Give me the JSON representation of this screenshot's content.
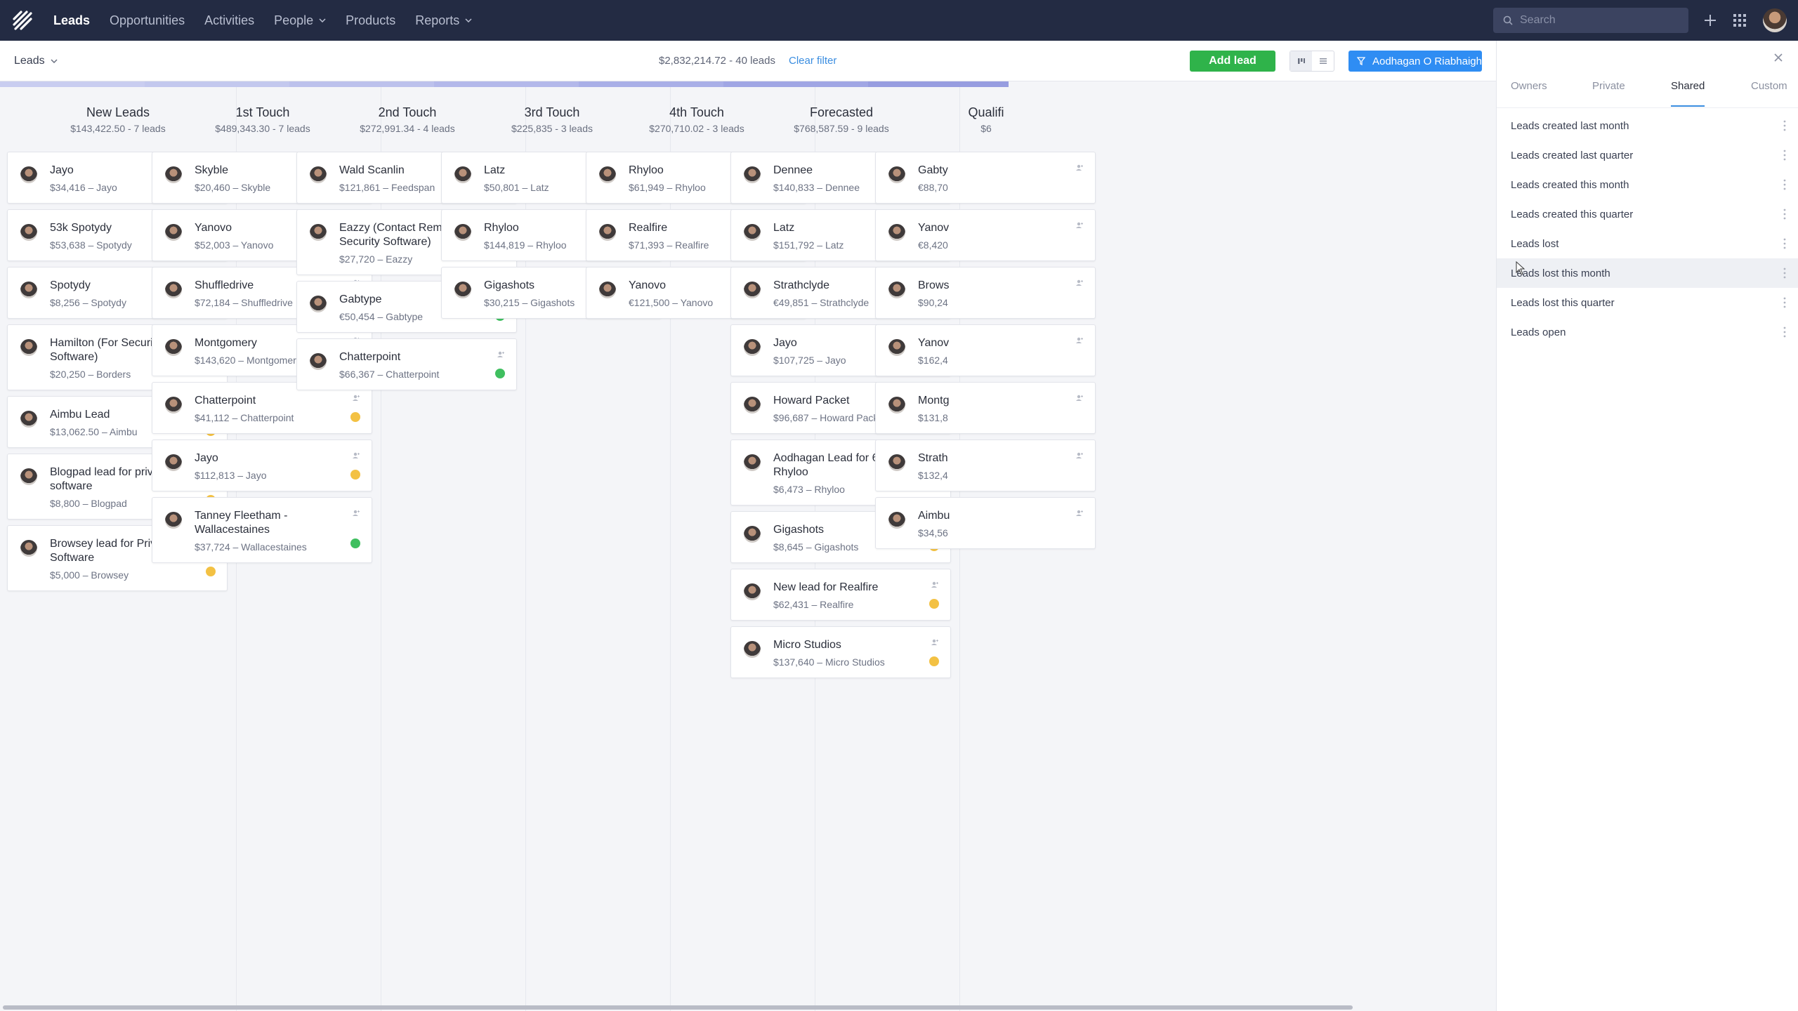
{
  "nav": {
    "items": [
      {
        "label": "Leads",
        "active": true,
        "dropdown": false
      },
      {
        "label": "Opportunities",
        "active": false,
        "dropdown": false
      },
      {
        "label": "Activities",
        "active": false,
        "dropdown": false
      },
      {
        "label": "People",
        "active": false,
        "dropdown": true
      },
      {
        "label": "Products",
        "active": false,
        "dropdown": false
      },
      {
        "label": "Reports",
        "active": false,
        "dropdown": true
      }
    ],
    "search_placeholder": "Search"
  },
  "toolbar": {
    "view_label": "Leads",
    "summary": "$2,832,214.72 - 40 leads",
    "clear_filter": "Clear filter",
    "add_lead": "Add lead",
    "owner_filter": "Aodhagan O Riabhaigh"
  },
  "columns": [
    {
      "title": "New Leads",
      "sub": "$143,422.50 - 7 leads",
      "color": "#c9cdf0",
      "cards": [
        {
          "title": "Jayo",
          "meta": "$34,416 – Jayo",
          "status": "yellow"
        },
        {
          "title": "53k Spotydy",
          "meta": "$53,638 – Spotydy",
          "status": "yellow"
        },
        {
          "title": "Spotydy",
          "meta": "$8,256 – Spotydy",
          "status": "yellow"
        },
        {
          "title": "Hamilton (For Security Software)",
          "meta": "$20,250 – Borders",
          "status": "yellow"
        },
        {
          "title": "Aimbu Lead",
          "meta": "$13,062.50 – Aimbu",
          "status": "yellow"
        },
        {
          "title": "Blogpad lead for privacy software",
          "meta": "$8,800 – Blogpad",
          "status": "yellow"
        },
        {
          "title": "Browsey lead for Privacy Software",
          "meta": "$5,000 – Browsey",
          "status": "yellow"
        }
      ]
    },
    {
      "title": "1st Touch",
      "sub": "$489,343.30 - 7 leads",
      "color": "#c3c8ee",
      "cards": [
        {
          "title": "Skyble",
          "meta": "$20,460 – Skyble",
          "status": "red"
        },
        {
          "title": "Yanovo",
          "meta": "$52,003 – Yanovo",
          "status": "yellow"
        },
        {
          "title": "Shuffledrive",
          "meta": "$72,184 – Shuffledrive",
          "status": "yellow"
        },
        {
          "title": "Montgomery",
          "meta": "$143,620 – Montgomery",
          "status": "yellow"
        },
        {
          "title": "Chatterpoint",
          "meta": "$41,112 – Chatterpoint",
          "status": "yellow"
        },
        {
          "title": "Jayo",
          "meta": "$112,813 – Jayo",
          "status": "yellow"
        },
        {
          "title": "Tanney Fleetham - Wallacestaines",
          "meta": "$37,724 – Wallacestaines",
          "status": "green"
        }
      ]
    },
    {
      "title": "2nd Touch",
      "sub": "$272,991.34 - 4 leads",
      "color": "#bcc1ec",
      "cards": [
        {
          "title": "Wald Scanlin",
          "meta": "$121,861 – Feedspan",
          "status": "yellow"
        },
        {
          "title": "Eazzy (Contact Remy Try for Security Software)",
          "meta": "$27,720 – Eazzy",
          "status": "yellow"
        },
        {
          "title": "Gabtype",
          "meta": "€50,454 – Gabtype",
          "status": "green"
        },
        {
          "title": "Chatterpoint",
          "meta": "$66,367 – Chatterpoint",
          "status": "green"
        }
      ]
    },
    {
      "title": "3rd Touch",
      "sub": "$225,835 - 3 leads",
      "color": "#b3b8ea",
      "cards": [
        {
          "title": "Latz",
          "meta": "$50,801 – Latz",
          "status": "yellow"
        },
        {
          "title": "Rhyloo",
          "meta": "$144,819 – Rhyloo",
          "status": "yellow"
        },
        {
          "title": "Gigashots",
          "meta": "$30,215 – Gigashots",
          "status": "yellow"
        }
      ]
    },
    {
      "title": "4th Touch",
      "sub": "$270,710.02 - 3 leads",
      "color": "#a9afe7",
      "cards": [
        {
          "title": "Rhyloo",
          "meta": "$61,949 – Rhyloo",
          "status": "red"
        },
        {
          "title": "Realfire",
          "meta": "$71,393 – Realfire",
          "status": "red"
        },
        {
          "title": "Yanovo",
          "meta": "€121,500 – Yanovo",
          "status": "yellow"
        }
      ]
    },
    {
      "title": "Forecasted",
      "sub": "$768,587.59 - 9 leads",
      "color": "#a0a6e4",
      "cards": [
        {
          "title": "Dennee",
          "meta": "$140,833 – Dennee",
          "status": "red"
        },
        {
          "title": "Latz",
          "meta": "$151,792 – Latz",
          "status": "red"
        },
        {
          "title": "Strathclyde",
          "meta": "€49,851 – Strathclyde",
          "status": "red"
        },
        {
          "title": "Jayo",
          "meta": "$107,725 – Jayo",
          "status": "yellow"
        },
        {
          "title": "Howard Packet",
          "meta": "$96,687 – Howard Packet",
          "status": "yellow"
        },
        {
          "title": "Aodhagan Lead for 6.5k Rhyloo",
          "meta": "$6,473 – Rhyloo",
          "status": "yellow"
        },
        {
          "title": "Gigashots",
          "meta": "$8,645 – Gigashots",
          "status": "yellow"
        },
        {
          "title": "New lead for Realfire",
          "meta": "$62,431 – Realfire",
          "status": "yellow"
        },
        {
          "title": "Micro Studios",
          "meta": "$137,640 – Micro Studios",
          "status": "yellow"
        }
      ]
    },
    {
      "title": "Qualifi",
      "sub": "$6",
      "color": "#979de0",
      "cards": [
        {
          "title": "Gabty",
          "meta": "€88,70",
          "status": ""
        },
        {
          "title": "Yanov",
          "meta": "€8,420",
          "status": ""
        },
        {
          "title": "Brows",
          "meta": "$90,24",
          "status": ""
        },
        {
          "title": "Yanov",
          "meta": "$162,4",
          "status": ""
        },
        {
          "title": "Montg",
          "meta": "$131,8",
          "status": ""
        },
        {
          "title": "Strath",
          "meta": "$132,4",
          "status": ""
        },
        {
          "title": "Aimbu",
          "meta": "$34,56",
          "status": ""
        }
      ]
    }
  ],
  "status_colors": {
    "yellow": "#f3c143",
    "red": "#ec5b5b",
    "green": "#3fbf5f"
  },
  "panel": {
    "tabs": [
      {
        "label": "Owners",
        "active": false
      },
      {
        "label": "Private",
        "active": false
      },
      {
        "label": "Shared",
        "active": true
      },
      {
        "label": "Custom",
        "active": false
      }
    ],
    "filters": [
      "Leads created last month",
      "Leads created last quarter",
      "Leads created this month",
      "Leads created this quarter",
      "Leads lost",
      "Leads lost this month",
      "Leads lost this quarter",
      "Leads open"
    ],
    "hovered_filter_index": 5
  }
}
